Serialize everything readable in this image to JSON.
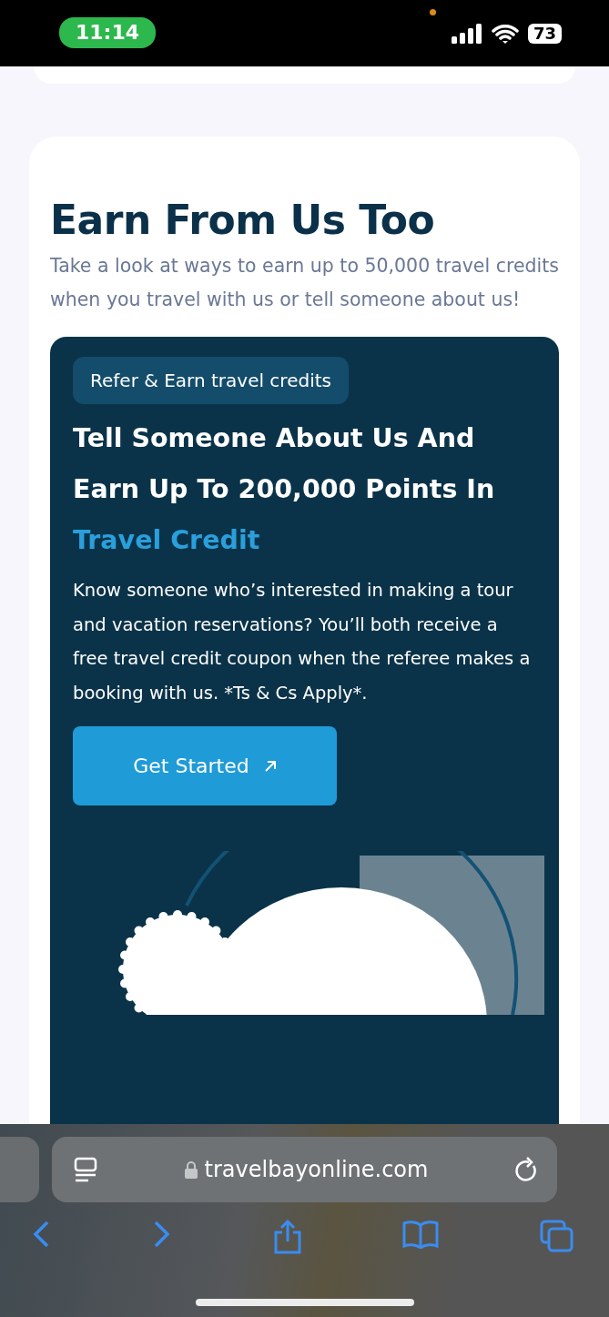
{
  "status_bar": {
    "time": "11:14",
    "battery": "73",
    "recording_dot": true
  },
  "section": {
    "heading": "Earn From Us Too",
    "intro": "Take a look at ways to earn up to 50,000 travel credits when you travel with us or tell someone about us!"
  },
  "promo": {
    "tag": "Refer & Earn travel credits",
    "title": "Tell Someone About Us And Earn Up To 200,000 Points In ",
    "title_highlight": "Travel Credit",
    "description": "Know someone who’s interested in making a tour and vacation reservations? You’ll both receive a free travel credit coupon when the referee makes a booking with us. *Ts & Cs Apply*.",
    "button": "Get Started"
  },
  "browser": {
    "url": "travelbayonline.com"
  }
}
